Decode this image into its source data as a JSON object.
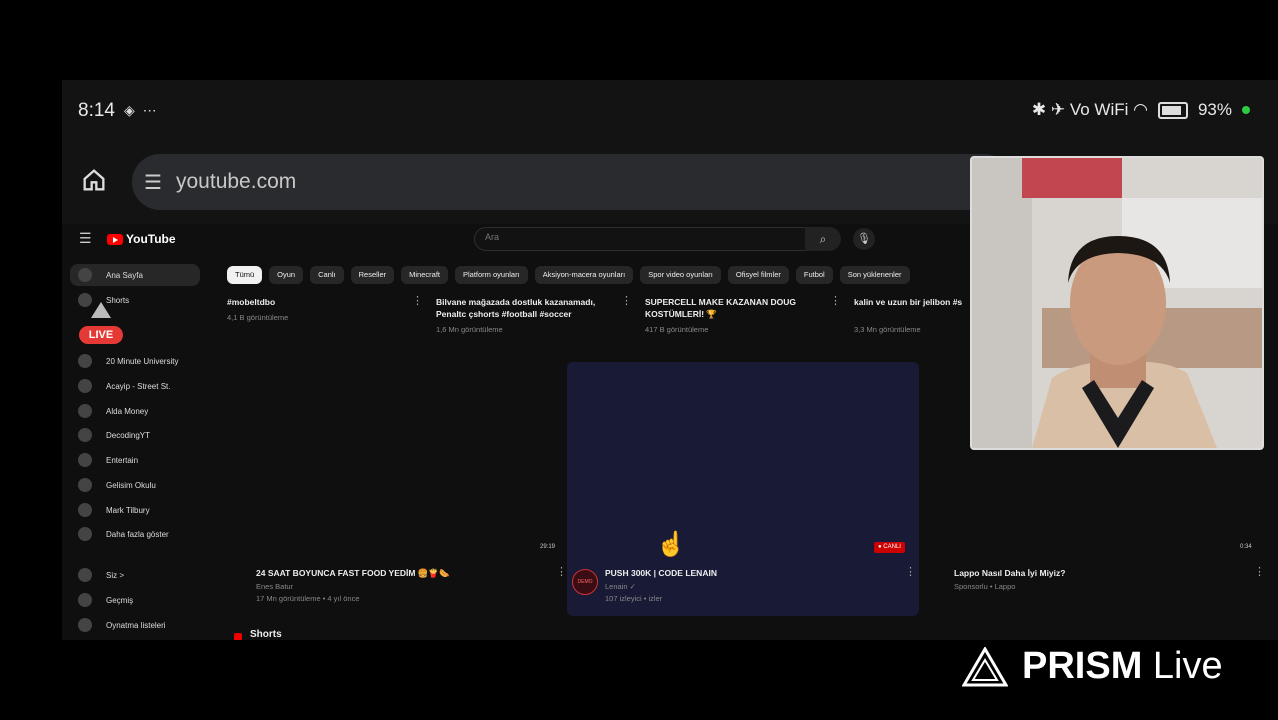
{
  "status_bar": {
    "time": "8:14",
    "left_icons": "◈ ⋯",
    "right_icons": "✱ ✈ Vo WiFi ◠",
    "battery": "93%"
  },
  "browser": {
    "url": "youtube.com"
  },
  "youtube": {
    "logo": "YouTube",
    "search_placeholder": "Ara",
    "sidebar": [
      {
        "label": "Ana Sayfa",
        "active": true
      },
      {
        "label": "Shorts"
      },
      {
        "label": "20 Minute University"
      },
      {
        "label": "Acayip - Street St."
      },
      {
        "label": "Alda Money"
      },
      {
        "label": "DecodingYT"
      },
      {
        "label": "Entertain"
      },
      {
        "label": "Gelisim Okulu"
      },
      {
        "label": "Mark Tilbury"
      },
      {
        "label": "Daha fazla göster"
      },
      {
        "label": "Siz >"
      },
      {
        "label": "Geçmiş"
      },
      {
        "label": "Oynatma listeleri"
      }
    ],
    "chips": [
      "Tümü",
      "Oyun",
      "Canlı",
      "Reseller",
      "Minecraft",
      "Platform oyunları",
      "Aksiyon-macera oyunları",
      "Spor video oyunları",
      "Ofisyel filmler",
      "Futbol",
      "Son yüklenenler"
    ],
    "top_row": [
      {
        "title": "#mobeltdbo",
        "meta": "4,1 B görüntüleme"
      },
      {
        "title": "Bilvane mağazada dostluk kazanamadı, Penaltc çshorts #football #soccer",
        "meta": "1,6 Mn görüntüleme"
      },
      {
        "title": "SUPERCELL MAKE KAZANAN DOUG KOSTÜMLERİ! 🏆",
        "meta": "417 B görüntüleme"
      },
      {
        "title": "kalin ve uzun bir jelibon #s",
        "meta": "3,3 Mn görüntüleme"
      }
    ],
    "videos": [
      {
        "title": "24 SAAT BOYUNCA FAST FOOD YEDİM 🍔🍟🌭",
        "channel": "Enes Batur",
        "meta": "17 Mn görüntüleme • 4 yıl önce",
        "duration": "29:19"
      },
      {
        "title": "PUSH 300K | CODE LENAIN",
        "channel": "Lenain ✓",
        "meta": "107 izleyici • izler",
        "badge": "● CANLI",
        "avatar": "DEMO"
      },
      {
        "title": "Lappo Nasıl Daha İyi Miyiz?",
        "channel": "Sponsorlu • Lappo",
        "meta": "",
        "duration": "0:34"
      }
    ],
    "shorts_label": "Shorts"
  },
  "overlay": {
    "live_badge": "LIVE",
    "prism_brand": "PRISM",
    "prism_suffix": "Live"
  }
}
